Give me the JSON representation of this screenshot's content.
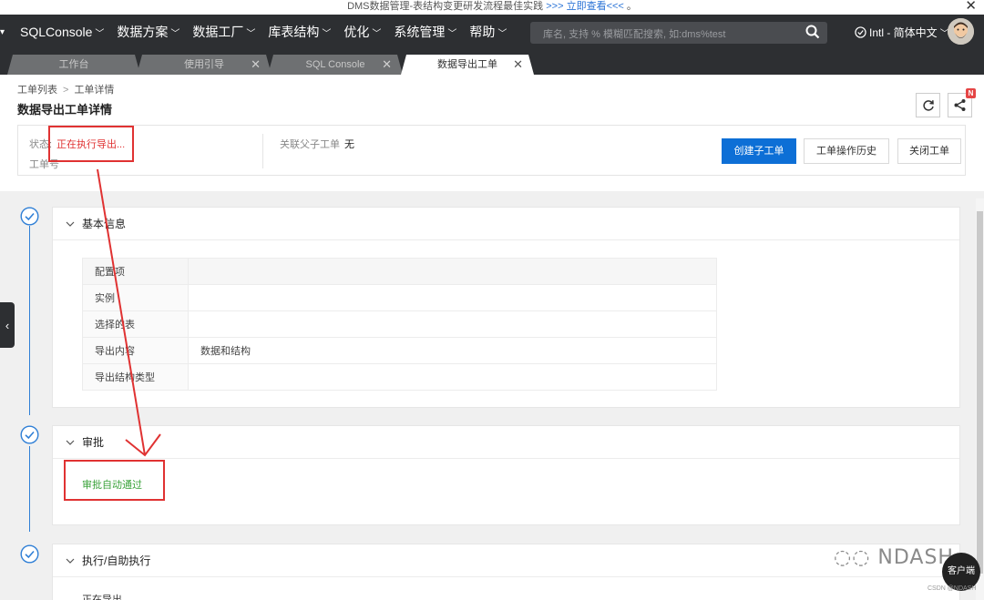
{
  "announcement": {
    "text": "DMS数据管理-表结构变更研发流程最佳实践",
    "link": ">>> 立即查看<<<",
    "suffix": "。"
  },
  "nav": {
    "items": [
      "SQLConsole",
      "数据方案",
      "数据工厂",
      "库表结构",
      "优化",
      "系统管理",
      "帮助"
    ],
    "search_placeholder": "库名, 支持 % 模糊匹配搜索, 如:dms%test",
    "lang": "Intl - 简体中文"
  },
  "tabs": [
    "工作台",
    "使用引导",
    "SQL Console",
    "数据导出工单"
  ],
  "breadcrumb": [
    "工单列表",
    "工单详情"
  ],
  "page_title": "数据导出工单详情",
  "info": {
    "status_label": "状态:",
    "status_value": "正在执行导出...",
    "order_label": "工单号",
    "parent_label": "关联父子工单",
    "parent_value": "无"
  },
  "buttons": {
    "create_child": "创建子工单",
    "history": "工单操作历史",
    "close": "关闭工单"
  },
  "basic_info": {
    "title": "基本信息",
    "rows": [
      {
        "key": "配置项",
        "value": ""
      },
      {
        "key": "实例",
        "value": ""
      },
      {
        "key": "选择的表",
        "value": ""
      },
      {
        "key": "导出内容",
        "value": "数据和结构"
      },
      {
        "key": "导出结构类型",
        "value": ""
      }
    ]
  },
  "approval": {
    "title": "审批",
    "status": "审批自动通过"
  },
  "execution": {
    "title": "执行/自助执行",
    "status": "正在导出"
  },
  "watermark": "NDASH",
  "client_button": "客户端",
  "csdn_mark": "CSDN @NDASH",
  "colors": {
    "nav_bg": "#2d2f32",
    "primary": "#0d6fd6",
    "status_red": "#e03232",
    "approved_green": "#3aa23a",
    "timeline_blue": "#2f7fd6"
  }
}
